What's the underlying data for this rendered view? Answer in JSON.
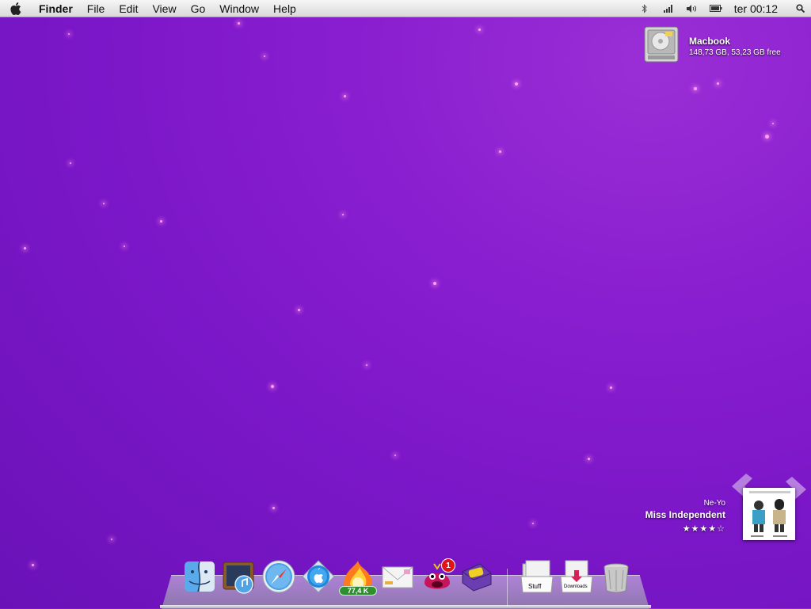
{
  "menubar": {
    "app_name": "Finder",
    "menus": [
      "File",
      "Edit",
      "View",
      "Go",
      "Window",
      "Help"
    ],
    "clock": "ter 00:12",
    "status_icons": [
      "bluetooth-icon",
      "wifi-signal-icon",
      "volume-icon",
      "battery-icon"
    ]
  },
  "desktop": {
    "disk": {
      "name": "Macbook",
      "info": "148,73 GB, 53,23 GB free"
    }
  },
  "now_playing": {
    "artist": "Ne-Yo",
    "title": "Miss Independent",
    "rating": "★★★★☆"
  },
  "dock": {
    "items": [
      {
        "name": "finder",
        "icon": "finder-icon"
      },
      {
        "name": "itunes",
        "icon": "itunes-icon"
      },
      {
        "name": "safari",
        "icon": "safari-compass-icon"
      },
      {
        "name": "app-store",
        "icon": "app-store-icon"
      },
      {
        "name": "transmission",
        "icon": "fire-download-icon",
        "badge": "77,4 K"
      },
      {
        "name": "mail",
        "icon": "mail-envelope-icon"
      },
      {
        "name": "growl-monster",
        "icon": "red-monster-icon",
        "badge": "1"
      },
      {
        "name": "adium",
        "icon": "box-app-icon"
      },
      {
        "name": "stuff-folder",
        "icon": "stuff-folder-icon",
        "label": "Stuff"
      },
      {
        "name": "downloads-folder",
        "icon": "downloads-folder-icon",
        "label": "Downloads"
      },
      {
        "name": "trash",
        "icon": "trash-icon"
      }
    ]
  },
  "colors": {
    "desktop_background": "#7b17c8",
    "menubar": "#e6e6e6",
    "badge_red": "#e0131b",
    "badge_green": "#2f8f2f"
  }
}
